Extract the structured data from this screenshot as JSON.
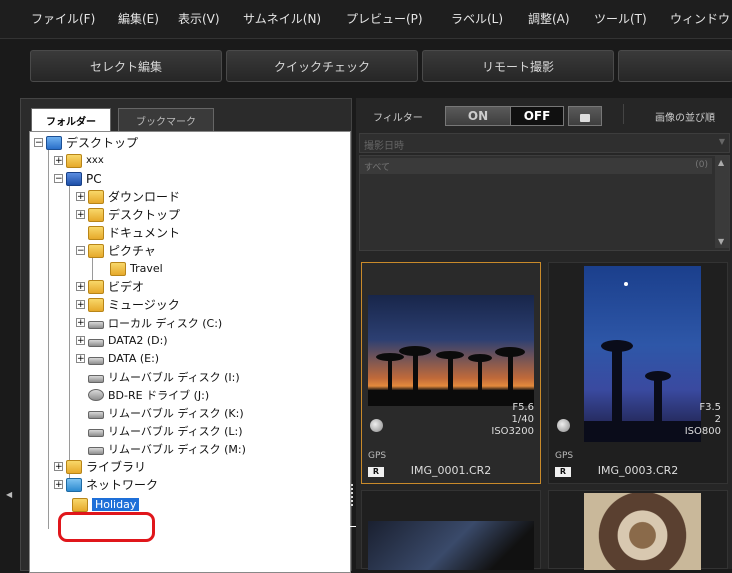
{
  "menubar": {
    "items": [
      {
        "label": "ファイル(F)"
      },
      {
        "label": "編集(E)"
      },
      {
        "label": "表示(V)"
      },
      {
        "label": "サムネイル(N)"
      },
      {
        "label": "プレビュー(P)"
      },
      {
        "label": "ラベル(L)"
      },
      {
        "label": "調整(A)"
      },
      {
        "label": "ツール(T)"
      },
      {
        "label": "ウィンドウ"
      }
    ]
  },
  "toolbar": {
    "select_edit": "セレクト編集",
    "quick_check": "クイックチェック",
    "remote_shoot": "リモート撮影"
  },
  "leftpanel": {
    "tab_folder": "フォルダー",
    "tab_bookmark": "ブックマーク",
    "tree": {
      "desktop": "デスクトップ",
      "xxx": "xxx",
      "pc": "PC",
      "downloads": "ダウンロード",
      "desktop2": "デスクトップ",
      "documents": "ドキュメント",
      "pictures": "ピクチャ",
      "travel": "Travel",
      "video": "ビデオ",
      "music": "ミュージック",
      "local_c": "ローカル ディスク (C:)",
      "data2_d": "DATA2 (D:)",
      "data_e": "DATA (E:)",
      "removable_i": "リムーバブル ディスク (I:)",
      "bdre_j": "BD-RE ドライブ (J:)",
      "removable_k": "リムーバブル ディスク (K:)",
      "removable_l": "リムーバブル ディスク (L:)",
      "removable_m": "リムーバブル ディスク (M:)",
      "library": "ライブラリ",
      "network": "ネットワーク",
      "holiday": "Holiday"
    }
  },
  "filter": {
    "label": "フィルター",
    "on": "ON",
    "off": "OFF",
    "sort_label": "画像の並び順",
    "sort_value": "撮影日時",
    "list_item": "すべて",
    "list_count": "(0)"
  },
  "thumbs": [
    {
      "aperture": "F5.6",
      "shutter": "1/40",
      "iso": "ISO3200",
      "gps": "GPS",
      "raw": "R",
      "filename": "IMG_0001.CR2"
    },
    {
      "aperture": "F3.5",
      "shutter": "2",
      "iso": "ISO800",
      "gps": "GPS",
      "raw": "R",
      "filename": "IMG_0003.CR2"
    }
  ],
  "colors": {
    "accent_selection": "#c98a2a",
    "highlight_ring": "#e0161b",
    "selected_item_bg": "#1e6fd8"
  }
}
